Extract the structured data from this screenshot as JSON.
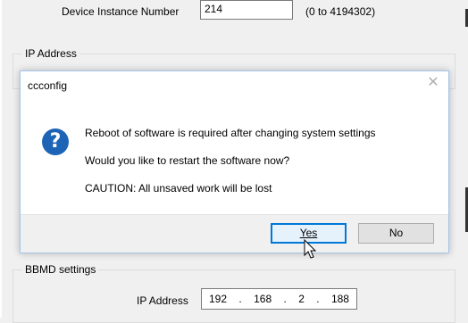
{
  "background": {
    "device_instance_label": "Device Instance Number",
    "device_instance_value": "214",
    "device_instance_range": "(0 to 4194302)",
    "ip_group_title": "IP Address",
    "bbmd_group_title": "BBMD settings",
    "bbmd_ip_label": "IP Address",
    "bbmd_ip": [
      "192",
      "168",
      "2",
      "188"
    ],
    "bbmd_ip_separator": "."
  },
  "dialog": {
    "title": "ccconfig",
    "icon": "question-icon",
    "icon_glyph": "?",
    "close_glyph": "✕",
    "messages": [
      "Reboot of software is required after changing system settings",
      "Would you like to restart the software now?",
      "CAUTION: All unsaved work will be lost"
    ],
    "buttons": {
      "yes": "Yes",
      "no": "No"
    },
    "accent_color": "#0078d7",
    "icon_color": "#1d64b6"
  }
}
